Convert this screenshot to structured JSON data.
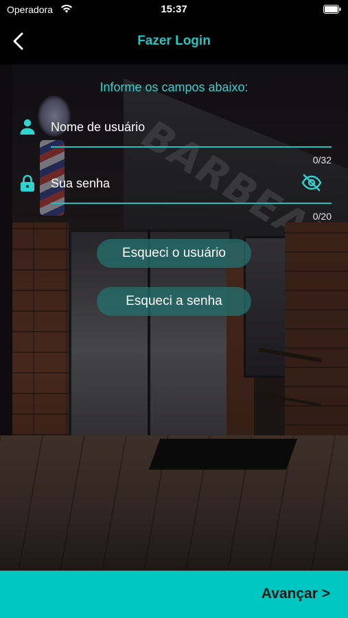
{
  "status_bar": {
    "carrier": "Operadora",
    "time": "15:37",
    "wifi_icon": "wifi-icon",
    "battery_icon": "battery-icon"
  },
  "nav": {
    "title": "Fazer Login",
    "back_icon": "chevron-left-icon"
  },
  "form": {
    "heading": "Informe os campos abaixo:",
    "username": {
      "placeholder": "Nome de usuário",
      "value": "",
      "counter": "0/32",
      "icon": "person-icon"
    },
    "password": {
      "placeholder": "Sua senha",
      "value": "",
      "counter": "0/20",
      "icon": "lock-icon",
      "toggle_icon": "eye-slash-icon"
    },
    "forgot_username_label": "Esqueci o usuário",
    "forgot_password_label": "Esqueci a senha"
  },
  "background": {
    "sign_text": "BARBEARIA"
  },
  "footer": {
    "next_label": "Avançar >"
  },
  "colors": {
    "accent": "#1fc7c5",
    "footer_bg": "#00c6c2",
    "button_bg": "#246e6c"
  }
}
